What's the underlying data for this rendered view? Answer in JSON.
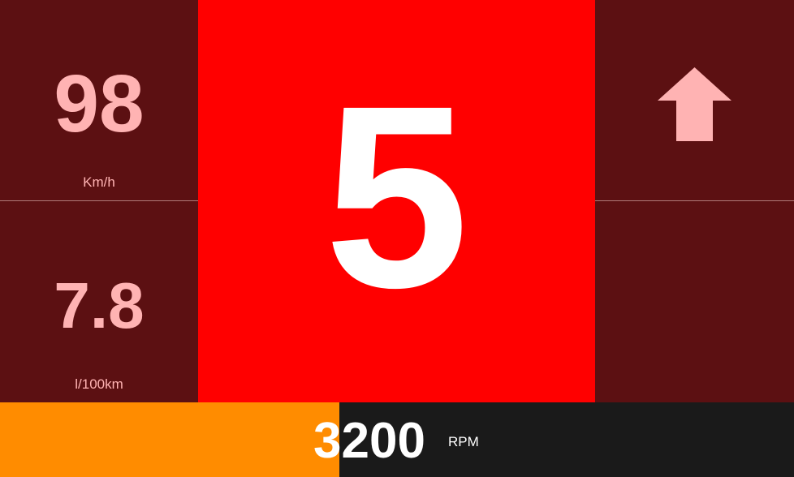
{
  "speed": {
    "value": "98",
    "unit": "Km/h"
  },
  "consumption": {
    "value": "7.8",
    "unit": "l/100km"
  },
  "gear": {
    "value": "5"
  },
  "shift_indicator": {
    "icon": "arrow-up-icon",
    "direction": "up"
  },
  "rpm": {
    "value": "3200",
    "unit": "RPM",
    "fill_fraction": 0.427
  },
  "colors": {
    "panel": "#5c1012",
    "gear_background": "#ff0000",
    "value_text": "#ffb3b3",
    "rpm_fill": "#ff8c00",
    "rpm_track": "#1a1a1a"
  }
}
